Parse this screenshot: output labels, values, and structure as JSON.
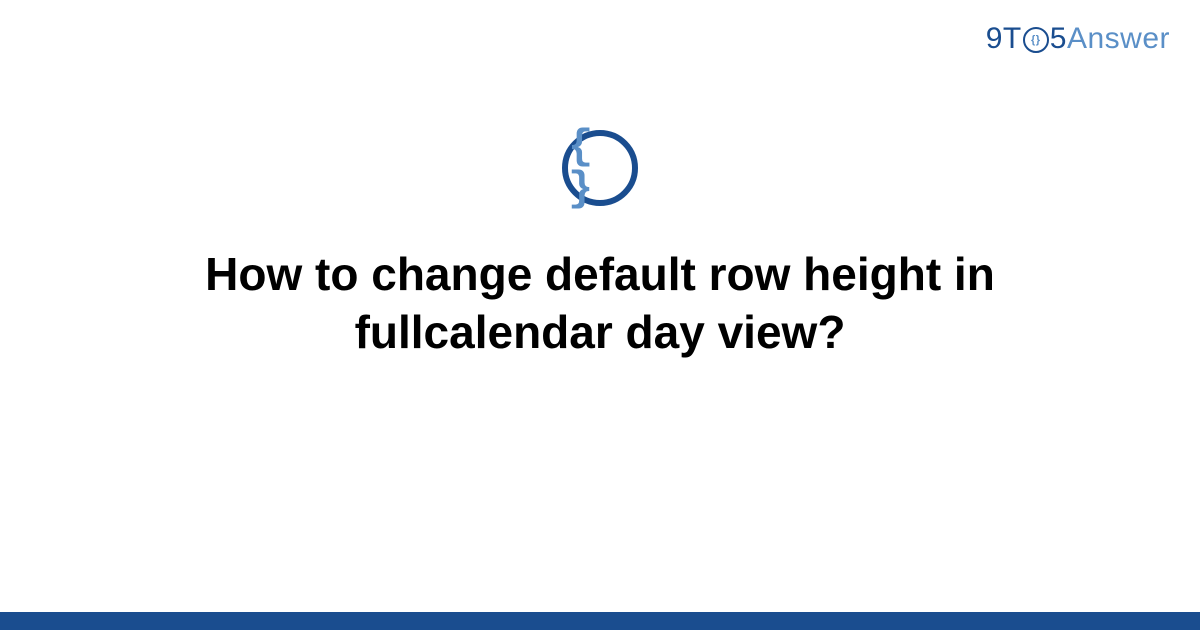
{
  "logo": {
    "part1": "9T",
    "circle_inner": "{}",
    "part2": "5",
    "part3": "Answer"
  },
  "category_icon": {
    "name": "code-braces",
    "symbol": "{ }"
  },
  "title": "How to change default row height in fullcalendar day view?",
  "colors": {
    "primary": "#1a4d8f",
    "secondary": "#5a8fc7"
  }
}
